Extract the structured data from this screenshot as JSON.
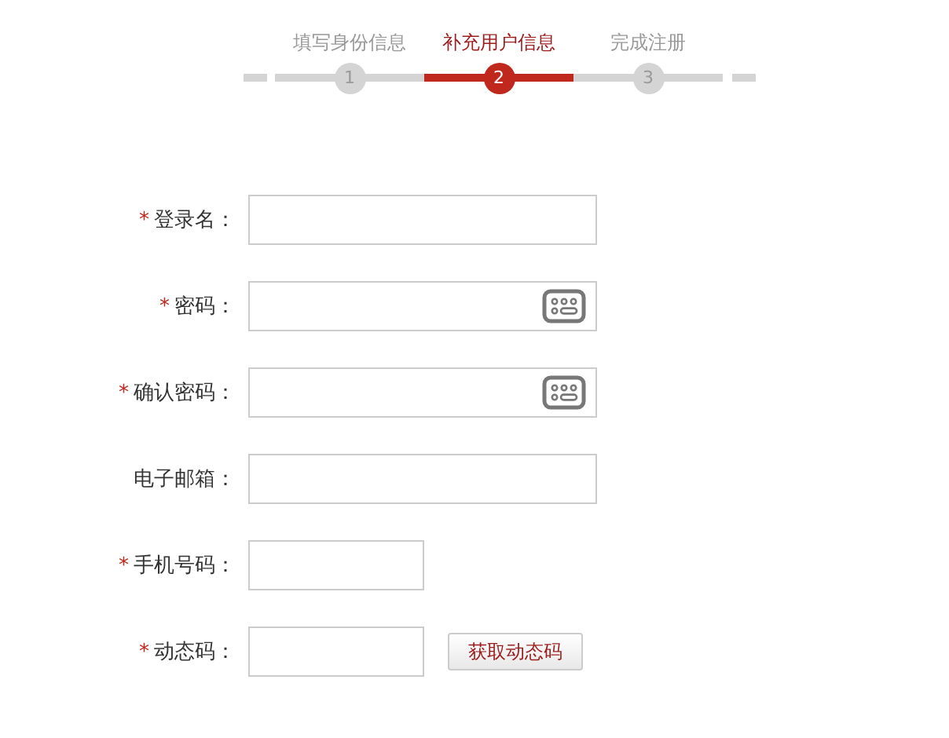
{
  "steps": [
    {
      "label": "填写身份信息",
      "number": "1",
      "selected": false
    },
    {
      "label": "补充用户信息",
      "number": "2",
      "selected": true
    },
    {
      "label": "完成注册",
      "number": "3",
      "selected": false
    }
  ],
  "form": [
    {
      "kind": "text",
      "label": "登录名：",
      "marker": "*"
    },
    {
      "kind": "password",
      "label": "密码：",
      "marker": "*"
    },
    {
      "kind": "password",
      "label": "确认密码：",
      "marker": "*"
    },
    {
      "kind": "text",
      "label": "电子邮箱："
    },
    {
      "kind": "short",
      "label": "手机号码：",
      "marker": "*"
    },
    {
      "kind": "code",
      "label": "动态码：",
      "marker": "*",
      "button": "获取动态码"
    }
  ]
}
